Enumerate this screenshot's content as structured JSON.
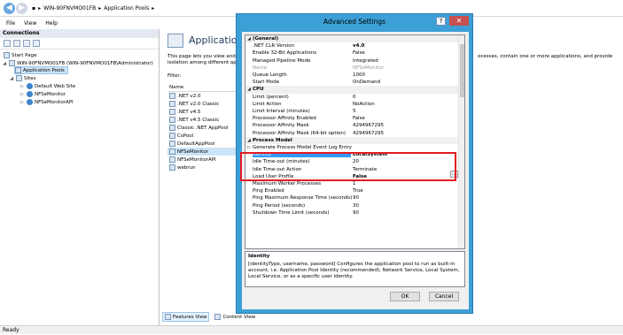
{
  "window": {
    "breadcrumb": [
      "WIN-90FNVMO01FB",
      "Application Pools"
    ],
    "menu": [
      "File",
      "View",
      "Help"
    ]
  },
  "connections": {
    "header": "Connections",
    "tree": [
      {
        "label": "Start Page"
      },
      {
        "label": "WIN-90FNVMO01FB (WIN-90FNVMO01FB\\Administrator)"
      },
      {
        "label": "Application Pools"
      },
      {
        "label": "Sites"
      },
      {
        "label": "Default Web Site"
      },
      {
        "label": "NFSeMonitor"
      },
      {
        "label": "NFSeMonitorAPI"
      }
    ]
  },
  "main": {
    "title": "Application",
    "description": "This page lets you view and manage the list of application pools on the server. Application pools are associated with worker processes, contain one or more applications, and provide isolation among different applications.",
    "desc_left": "This page lets you view and m... isolation among different app...",
    "desc_right": "ocesses, contain one or more applications, and provide",
    "filter_label": "Filter:",
    "list_header": "Name",
    "pools": [
      ".NET v2.0",
      ".NET v2.0 Classic",
      ".NET v4.5",
      ".NET v4.5 Classic",
      "Classic .NET AppPool",
      "CsPool",
      "DefaultAppPool",
      "NFSeMonitor",
      "NFSeMonitorAPI",
      "webrun"
    ],
    "tabs": [
      "Features View",
      "Content View"
    ]
  },
  "status": "Ready",
  "dialog": {
    "title": "Advanced Settings",
    "help": "?",
    "close": "✕",
    "rows": [
      {
        "name": "(General)",
        "value": "",
        "cat": true
      },
      {
        "name": ".NET CLR Version",
        "value": "v4.0",
        "bold": true
      },
      {
        "name": "Enable 32-Bit Applications",
        "value": "False"
      },
      {
        "name": "Managed Pipeline Mode",
        "value": "Integrated"
      },
      {
        "name": "Name",
        "value": "NFSeMonitor",
        "dim": true
      },
      {
        "name": "Queue Length",
        "value": "1000"
      },
      {
        "name": "Start Mode",
        "value": "OnDemand"
      },
      {
        "name": "CPU",
        "value": "",
        "cat": true
      },
      {
        "name": "Limit (percent)",
        "value": "0"
      },
      {
        "name": "Limit Action",
        "value": "NoAction"
      },
      {
        "name": "Limit Interval (minutes)",
        "value": "5"
      },
      {
        "name": "Processor Affinity Enabled",
        "value": "False"
      },
      {
        "name": "Processor Affinity Mask",
        "value": "4294967295"
      },
      {
        "name": "Processor Affinity Mask (64-bit option)",
        "value": "4294967295"
      },
      {
        "name": "Process Model",
        "value": "",
        "cat": true
      },
      {
        "name": "Generate Process Model Event Log Entry",
        "value": "",
        "sub": true
      },
      {
        "name": "Identity",
        "value": "LocalSystem",
        "selected": true
      },
      {
        "name": "Idle Time-out (minutes)",
        "value": "20"
      },
      {
        "name": "Idle Time-out Action",
        "value": "Terminate"
      },
      {
        "name": "Load User Profile",
        "value": "False",
        "bold": true
      },
      {
        "name": "Maximum Worker Processes",
        "value": "1"
      },
      {
        "name": "Ping Enabled",
        "value": "True"
      },
      {
        "name": "Ping Maximum Response Time (seconds)",
        "value": "90"
      },
      {
        "name": "Ping Period (seconds)",
        "value": "30"
      },
      {
        "name": "Shutdown Time Limit (seconds)",
        "value": "90"
      }
    ],
    "desc_title": "Identity",
    "desc_text": "[identityType, username, password] Configures the application pool to run as built-in account, i.e. Application Pool Identity (recommended), Network Service, Local System, Local Service, or as a specific user identity.",
    "ok": "OK",
    "cancel": "Cancel",
    "ellipsis": "..."
  }
}
